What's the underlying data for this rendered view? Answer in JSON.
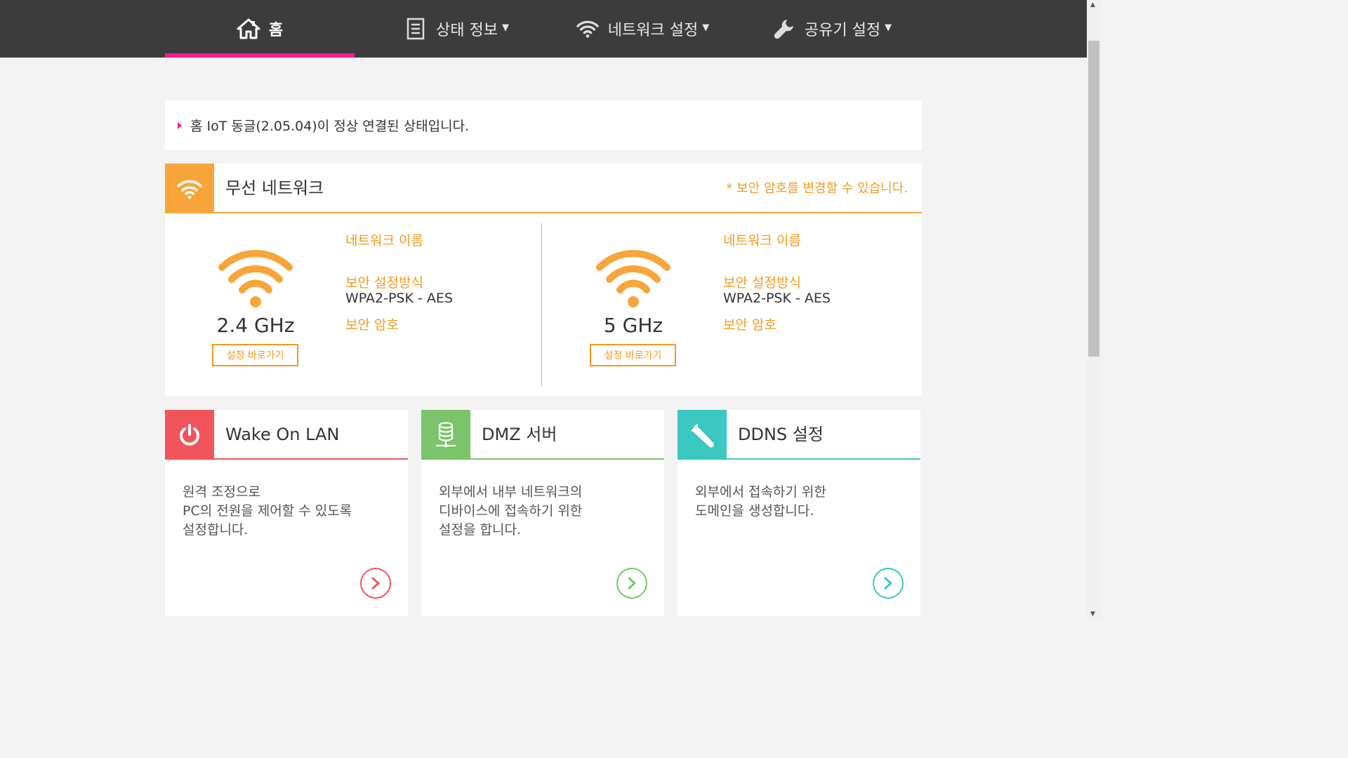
{
  "nav": {
    "home": {
      "label": "홈",
      "icon": "home-icon"
    },
    "status": {
      "label": "상태 정보",
      "icon": "document-icon"
    },
    "network": {
      "label": "네트워크 설정",
      "icon": "wifi-icon"
    },
    "router": {
      "label": "공유기 설정",
      "icon": "wrench-icon"
    },
    "caret": "▼"
  },
  "notice": {
    "text": "홈 IoT 동글(2.05.04)이 정상 연결된 상태입니다."
  },
  "wireless": {
    "title": "무선 네트워크",
    "hint": "* 보안 암호를 변경할 수 있습니다.",
    "bands": [
      {
        "freq": "2.4 GHz",
        "shortcut": "설정 바로가기",
        "network_name_label": "네트워크 이름",
        "network_name": "",
        "security_label": "보안 설정방식",
        "security": "WPA2-PSK - AES",
        "password_label": "보안 암호",
        "password": ""
      },
      {
        "freq": "5 GHz",
        "shortcut": "설정 바로가기",
        "network_name_label": "네트워크 이름",
        "network_name": "",
        "security_label": "보안 설정방식",
        "security": "WPA2-PSK - AES",
        "password_label": "보안 암호",
        "password": ""
      }
    ]
  },
  "cards": [
    {
      "title": "Wake On LAN",
      "icon": "power-icon",
      "desc": [
        "원격 조정으로",
        "PC의 전원을 제어할 수 있도록",
        "설정합니다."
      ]
    },
    {
      "title": "DMZ 서버",
      "icon": "server-icon",
      "desc": [
        "외부에서 내부 네트워크의",
        "디바이스에 접속하기 위한",
        "설정을 합니다."
      ]
    },
    {
      "title": "DDNS 설정",
      "icon": "wrench-icon",
      "desc": [
        "외부에서 접속하기 위한",
        "도메인을 생성합니다."
      ]
    }
  ],
  "colors": {
    "nav_bg": "#3c3c3c",
    "accent_pink": "#ff1a8c",
    "wireless_orange": "#f7a53a",
    "wol_red": "#f2545b",
    "dmz_green": "#7cc46a",
    "ddns_teal": "#3bc7c2"
  }
}
